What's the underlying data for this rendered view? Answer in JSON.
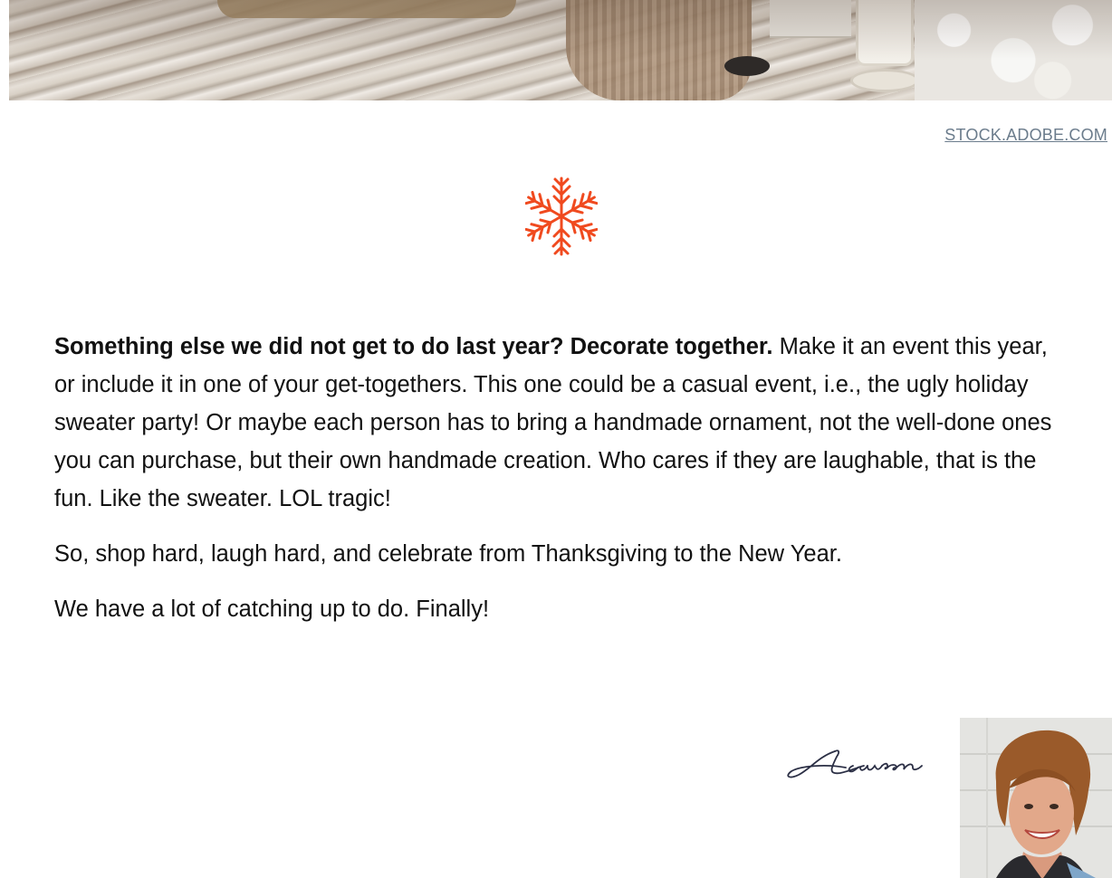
{
  "hero": {
    "credit_label": "STOCK.ADOBE.COM"
  },
  "decoration": {
    "snowflake_icon": "snowflake-icon",
    "accent_color": "#f04a1f"
  },
  "article": {
    "paragraph1_lead": "Something else we did not get to do last year? Decorate together.",
    "paragraph1_body": " Make it an event this year, or include it in one of your get-togethers. This one could be a casual event, i.e., the ugly holiday sweater party! Or maybe each person has to bring a handmade ornament, not the well-done ones you can purchase, but their own handmade creation. Who cares if they are laughable, that is the fun. Like the sweater. LOL tragic!",
    "paragraph2": "So, shop hard, laugh hard, and celebrate from Thanksgiving to the New Year.",
    "paragraph3": "We have a lot of catching up to do. Finally!"
  },
  "author": {
    "signature": "Lauren"
  },
  "colors": {
    "credit_link": "#6b7c8c",
    "body_text": "#111111"
  }
}
